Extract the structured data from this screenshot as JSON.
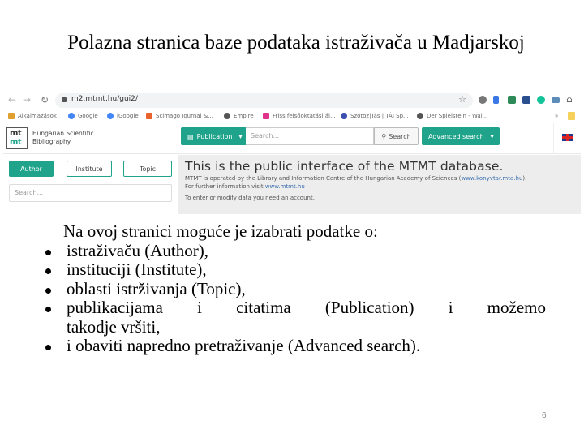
{
  "slide": {
    "title": "Polazna stranica baze podataka istraživača u Madjarskoj",
    "intro": "Na ovoj stranici moguće je izabrati podatke o:",
    "bullets": [
      "istraživaču (Author),",
      "instituciji (Institute),",
      "oblasti istrživanja (Topic),",
      "publikacijama i citatima (Publication) i možemo",
      "i obaviti napredno pretraživanje (Advanced search)."
    ],
    "bullet4_continuation": "takodje vršiti,",
    "page_number": "6"
  },
  "browser": {
    "url": "m2.mtmt.hu/gui2/",
    "nav_icons": [
      "back-icon",
      "forward-icon",
      "reload-icon"
    ],
    "extensions": [
      {
        "name": "extension-gray-icon",
        "color": "#777777"
      },
      {
        "name": "extension-blue-arrow-icon",
        "color": "#3b78e7"
      },
      {
        "name": "extension-green-icon",
        "color": "#2e8b57"
      },
      {
        "name": "extension-download-icon",
        "color": "#2a4f8f"
      },
      {
        "name": "grammarly-icon",
        "color": "#15c39a"
      },
      {
        "name": "extension-camera-icon",
        "color": "#5b8db8"
      },
      {
        "name": "home-icon",
        "color": "#666666"
      }
    ],
    "bookmarks": [
      {
        "label": "Alkalmazások",
        "color": "#e0a030"
      },
      {
        "label": "Google",
        "color": "#4285f4"
      },
      {
        "label": "iGoogle",
        "color": "#4285f4"
      },
      {
        "label": "Scimago Journal &...",
        "color": "#e8642c"
      },
      {
        "label": "Empire",
        "color": "#555555"
      },
      {
        "label": "Friss felsőoktatási ál...",
        "color": "#e0338a"
      },
      {
        "label": "Szótoz|Tás | TÁI Sp...",
        "color": "#3a4fb0"
      },
      {
        "label": "Der Spielstein - Wal...",
        "color": "#555555"
      }
    ],
    "bookmarks_overflow": "»"
  },
  "site": {
    "logo_top": "mt",
    "logo_bottom": "mt",
    "logo_text_line1": "Hungarian Scientific",
    "logo_text_line2": "Bibliography",
    "publication_label": "Publication",
    "search_placeholder": "Search...",
    "search_button": "Search",
    "advanced_search": "Advanced search",
    "tabs": [
      "Author",
      "Institute",
      "Topic"
    ],
    "left_search_placeholder": "Search...",
    "info_title": "This is the public interface of the MTMT database.",
    "info_line1_pre": "MTMT is operated by the Library and Information Centre of the Hungarian Academy of Sciences (",
    "info_line1_link": "www.konyvtar.mta.hu",
    "info_line1_post": ").",
    "info_line2_pre": "For further information visit ",
    "info_line2_link": "www.mtmt.hu",
    "info_line3": "To enter or modify data you need an account.",
    "accent_color": "#1fa38a"
  }
}
